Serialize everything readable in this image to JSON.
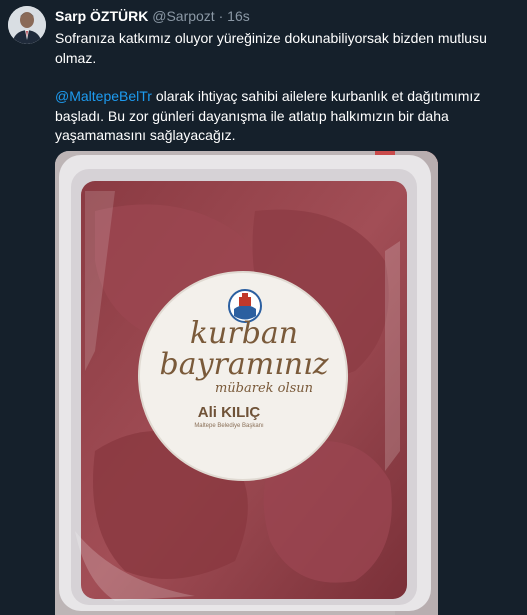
{
  "tweet": {
    "author_name": "Sarp ÖZTÜRK",
    "handle": "@Sarpozt",
    "separator": "·",
    "time": "16s",
    "paragraph1": "Sofranıza katkımız oluyor yüreğinize dokunabiliyorsak bizden mutlusu olmaz.",
    "mention": "@MaltepeBelTr",
    "paragraph2_rest": " olarak ihtiyaç sahibi ailelere kurbanlık et dağıtımımız başladı. Bu zor günleri dayanışma ile atlatıp halkımızın bir daha yaşamamasını sağlayacağız."
  },
  "media": {
    "label_line1": "kurban",
    "label_line2": "bayramınız",
    "label_line3": "mübarek olsun",
    "signature_name": "Ali KILIÇ",
    "signature_title": "Maltepe Belediye Başkanı"
  },
  "colors": {
    "background": "#15202b",
    "text": "#ffffff",
    "secondary_text": "#8b98a5",
    "link": "#1d9bf0",
    "label_text": "#7a5a3a"
  },
  "icons": [
    "avatar-photo",
    "municipality-logo"
  ]
}
